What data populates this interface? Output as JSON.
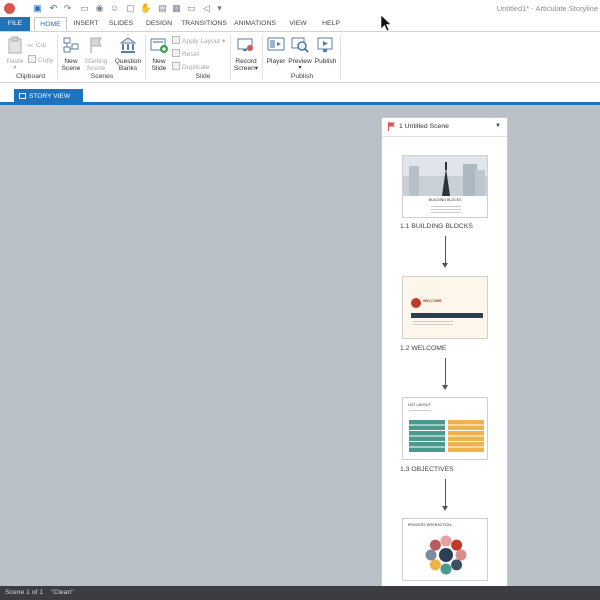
{
  "window": {
    "title": "Untitled1* - Articulate Storyline"
  },
  "quick_access": [
    {
      "name": "save-icon",
      "glyph": "▣"
    },
    {
      "name": "undo-icon",
      "glyph": "↶"
    },
    {
      "name": "redo-icon",
      "glyph": "↷"
    },
    {
      "name": "insert-slide-icon",
      "glyph": "▭"
    },
    {
      "name": "preview-icon",
      "glyph": "◉"
    },
    {
      "name": "user-icon",
      "glyph": "☺"
    },
    {
      "name": "comment-icon",
      "glyph": "▢"
    },
    {
      "name": "hand-icon",
      "glyph": "✋"
    },
    {
      "name": "lock-icon",
      "glyph": "▤"
    },
    {
      "name": "audio-icon",
      "glyph": "◁"
    },
    {
      "name": "more-icon",
      "glyph": "▾"
    }
  ],
  "tabs": [
    "FILE",
    "HOME",
    "INSERT",
    "SLIDES",
    "DESIGN",
    "TRANSITIONS",
    "ANIMATIONS",
    "VIEW",
    "HELP"
  ],
  "ribbon": {
    "clipboard": {
      "paste": "Paste",
      "cut": "Cut",
      "copy": "Copy",
      "label": "Clipboard"
    },
    "scenes": {
      "new_scene_1": "New",
      "new_scene_2": "Scene",
      "starting_1": "Starting",
      "starting_2": "Scene",
      "qbanks_1": "Question",
      "qbanks_2": "Banks",
      "label": "Scenes"
    },
    "slide": {
      "new_slide_1": "New",
      "new_slide_2": "Slide",
      "apply_layout": "Apply Layout",
      "reset": "Reset",
      "duplicate": "Duplicate",
      "label": "Slide"
    },
    "publish": {
      "record_1": "Record",
      "record_2": "Screen",
      "player": "Player",
      "preview": "Preview",
      "publish": "Publish",
      "label": "Publish"
    }
  },
  "view": {
    "story_view": "STORY VIEW"
  },
  "scene": {
    "title": "1 Untitled Scene",
    "slides": [
      {
        "label": "1.1 BUILDING BLOCKS",
        "thumb_title": "BUILDING BLOCKS"
      },
      {
        "label": "1.2 WELCOME",
        "thumb_title": "WELCOME"
      },
      {
        "label": "1.3 OBJECTIVES",
        "thumb_title": "LIST LAYOUT"
      },
      {
        "label": "",
        "thumb_title": "PROCESS INTERACTION"
      }
    ]
  },
  "status": {
    "scene": "Scene 1 of 1",
    "theme": "\"Clean\""
  },
  "colors": {
    "accent": "#1e73be",
    "canvas": "#b9c0c8",
    "teal": "#4b9a8e",
    "orange": "#f0b24a"
  }
}
